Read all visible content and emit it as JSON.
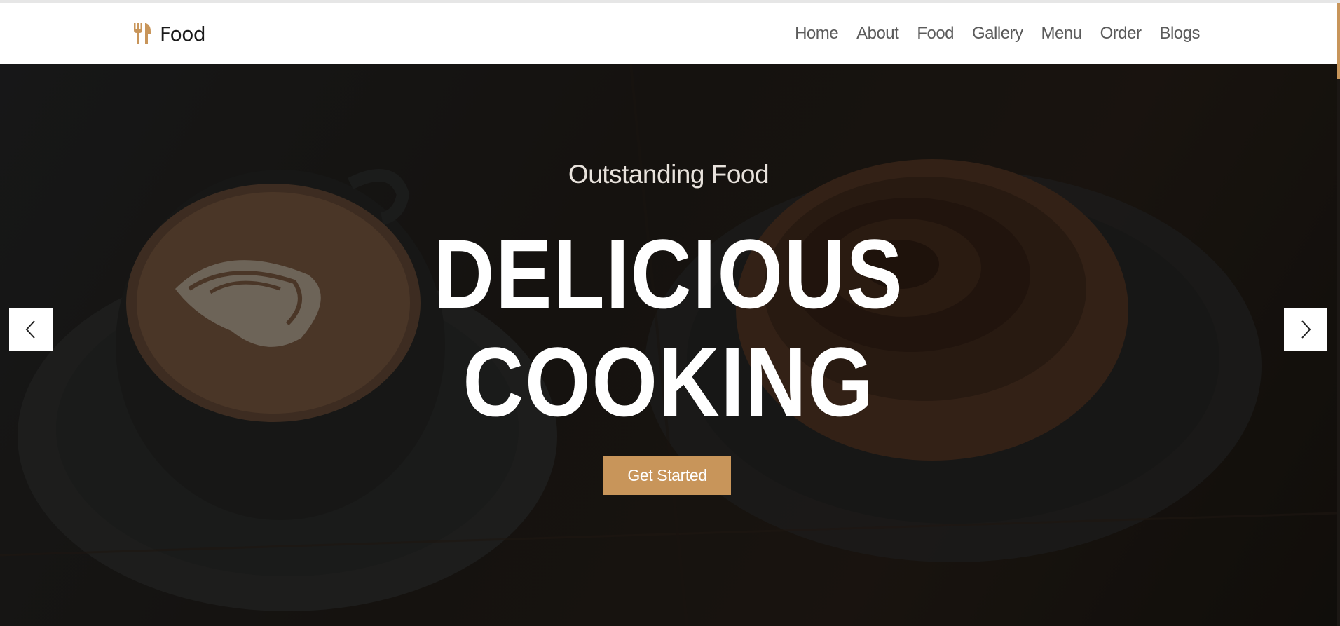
{
  "brand": {
    "name": "Food",
    "icon": "fork-spoon-icon",
    "accent": "#c8955a"
  },
  "nav": {
    "items": [
      "Home",
      "About",
      "Food",
      "Gallery",
      "Menu",
      "Order",
      "Blogs"
    ]
  },
  "hero": {
    "subtitle": "Outstanding Food",
    "title_line1": "DELICIOUS",
    "title_line2": "COOKING",
    "cta_label": "Get Started",
    "prev_icon": "chevron-left-icon",
    "next_icon": "chevron-right-icon"
  }
}
